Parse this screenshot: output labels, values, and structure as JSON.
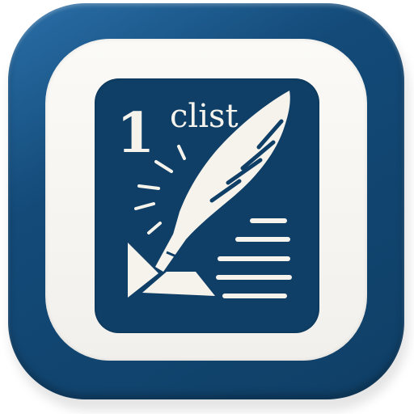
{
  "app_icon": {
    "number": "1",
    "word": "clist",
    "colors": {
      "navy": "#0f3f66",
      "outer_blue": "#134a78",
      "cream": "#f6f3ec"
    },
    "icons": [
      "quill-icon",
      "text-lines-icon",
      "sparkle-icon",
      "paper-corner-icon"
    ]
  }
}
